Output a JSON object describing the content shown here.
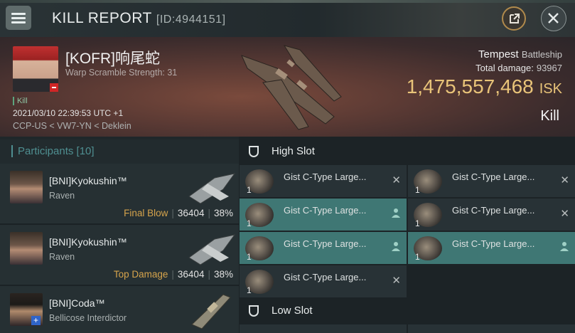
{
  "header": {
    "title": "KILL REPORT",
    "report_id": "[ID:4944151]"
  },
  "victim": {
    "name": "[KOFR]响尾蛇",
    "scram_label": "Warp Scramble Strength: 31",
    "kill_tag": "Kill",
    "timestamp": "2021/03/10 22:39:53 UTC +1",
    "location": "CCP-US < VW7-YN < Deklein"
  },
  "ship": {
    "name": "Tempest",
    "class": "Battleship",
    "total_damage_label": "Total damage:",
    "total_damage": "93967",
    "isk_value": "1,475,557,468",
    "isk_unit": "ISK",
    "result": "Kill"
  },
  "participants": {
    "title": "Participants [10]",
    "rows": [
      {
        "name": "[BNI]Kyokushin™",
        "ship": "Raven",
        "label": "Final Blow",
        "damage": "36404",
        "percent": "38%"
      },
      {
        "name": "[BNI]Kyokushin™",
        "ship": "Raven",
        "label": "Top Damage",
        "damage": "36404",
        "percent": "38%"
      },
      {
        "name": "[BNI]Coda™",
        "ship": "Bellicose Interdictor"
      }
    ]
  },
  "slots": {
    "high": {
      "title": "High Slot",
      "modules": [
        {
          "name": "Gist C-Type Large...",
          "qty": "1",
          "action": "x"
        },
        {
          "name": "Gist C-Type Large...",
          "qty": "1",
          "action": "x"
        },
        {
          "name": "Gist C-Type Large...",
          "qty": "1",
          "action": "pilot"
        },
        {
          "name": "Gist C-Type Large...",
          "qty": "1",
          "action": "x"
        },
        {
          "name": "Gist C-Type Large...",
          "qty": "1",
          "action": "pilot"
        },
        {
          "name": "Gist C-Type Large...",
          "qty": "1",
          "action": "pilot"
        },
        {
          "name": "Gist C-Type Large...",
          "qty": "1",
          "action": "x"
        }
      ]
    },
    "low": {
      "title": "Low Slot"
    }
  },
  "colors": {
    "accent_teal": "#4f8f91",
    "highlight_cell": "#3f7774",
    "isk_gold": "#e9c479",
    "label_orange": "#d6a44c"
  }
}
